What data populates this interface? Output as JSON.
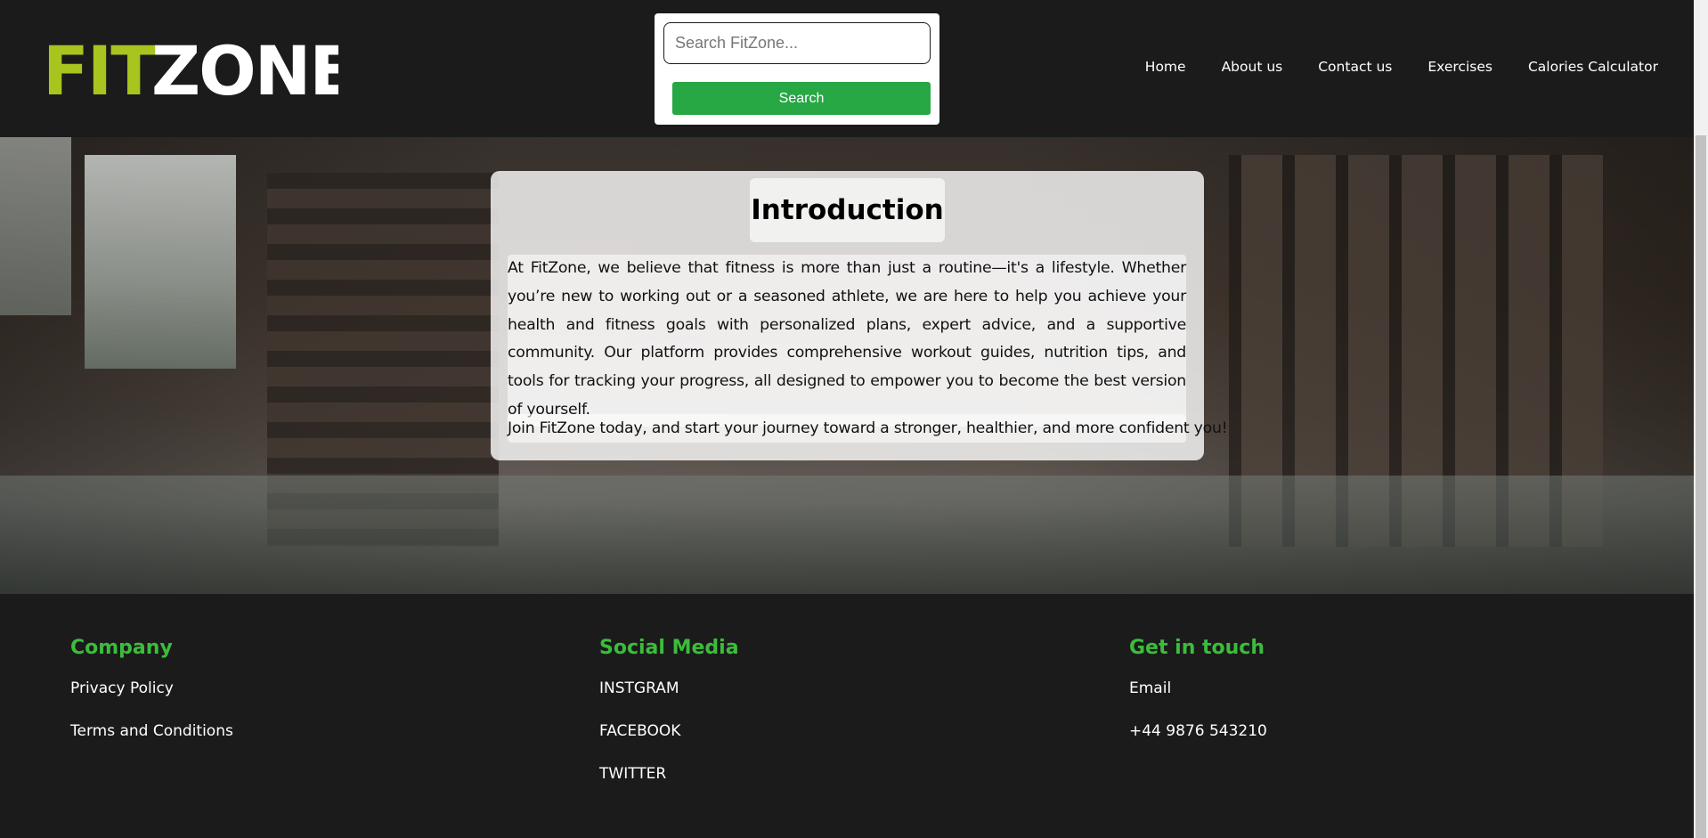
{
  "header": {
    "logo": {
      "part1": "FIT",
      "part2": "ZONE",
      "part1_color": "#a7c41f",
      "part2_color": "#ffffff"
    },
    "search": {
      "placeholder": "Search FitZone...",
      "value": "",
      "button_label": "Search",
      "button_color": "#28a745"
    },
    "nav": [
      {
        "label": "Home"
      },
      {
        "label": "About us"
      },
      {
        "label": "Contact us"
      },
      {
        "label": "Exercises"
      },
      {
        "label": "Calories Calculator"
      }
    ]
  },
  "hero": {
    "title": "Introduction",
    "paragraph1": "At FitZone, we believe that fitness is more than just a routine—it's a lifestyle. Whether you’re new to working out or a seasoned athlete, we are here to help you achieve your health and fitness goals with personalized plans, expert advice, and a supportive community. Our platform provides comprehensive workout guides, nutrition tips, and tools for tracking your progress, all designed to empower you to become the best version of yourself.",
    "paragraph2": "Join FitZone today, and start your journey toward a stronger, healthier, and more confident you!"
  },
  "footer": {
    "heading_color": "#3bbd3b",
    "columns": [
      {
        "heading": "Company",
        "links": [
          "Privacy Policy",
          "Terms and Conditions"
        ]
      },
      {
        "heading": "Social Media",
        "links": [
          "INSTGRAM",
          "FACEBOOK",
          "TWITTER"
        ]
      },
      {
        "heading": "Get in touch",
        "links": [
          "Email",
          "+44 9876 543210"
        ]
      }
    ]
  }
}
